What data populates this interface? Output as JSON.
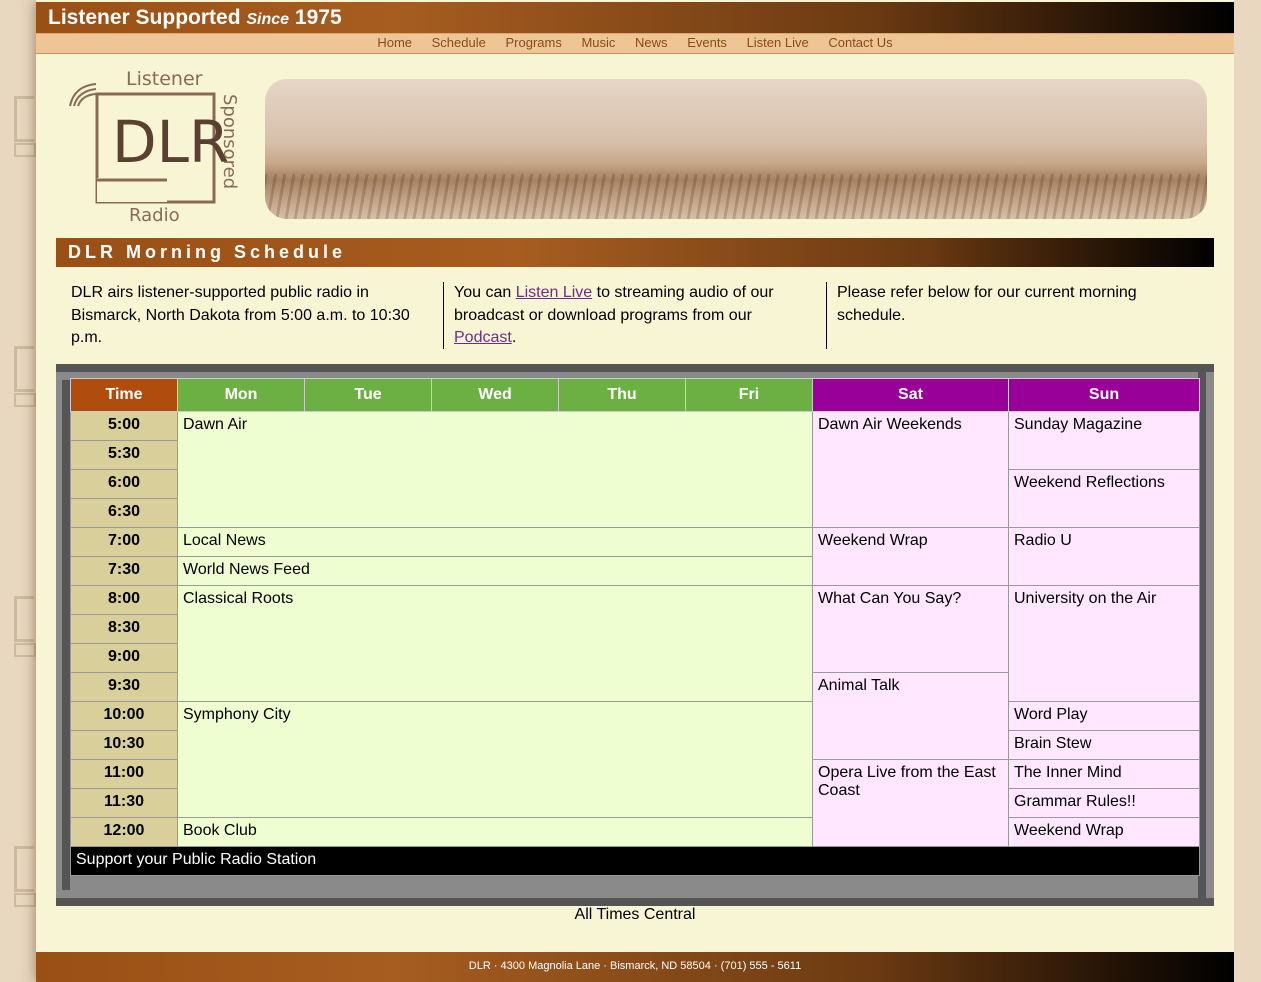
{
  "header": {
    "title_main": "Listener Supported",
    "title_since": "Since",
    "title_year": "1975"
  },
  "nav": [
    "Home",
    "Schedule",
    "Programs",
    "Music",
    "News",
    "Events",
    "Listen Live",
    "Contact Us"
  ],
  "logo": {
    "top_text": "Listener",
    "center_text": "DLR",
    "side_text": "Sponsored",
    "bottom_text": "Radio"
  },
  "section_title": "DLR Morning Schedule",
  "intro": {
    "col1": "DLR airs listener-supported public radio in Bismarck, North Dakota from 5:00 a.m. to 10:30 p.m.",
    "col2_pre": "You can ",
    "col2_link1": "Listen Live",
    "col2_mid": " to streaming audio of our broadcast or download programs from our ",
    "col2_link2": "Podcast",
    "col2_post": ".",
    "col3": "Please refer below for our current morning schedule."
  },
  "schedule": {
    "headers": {
      "time": "Time",
      "weekdays": [
        "Mon",
        "Tue",
        "Wed",
        "Thu",
        "Fri"
      ],
      "sat": "Sat",
      "sun": "Sun"
    },
    "times": [
      "5:00",
      "5:30",
      "6:00",
      "6:30",
      "7:00",
      "7:30",
      "8:00",
      "8:30",
      "9:00",
      "9:30",
      "10:00",
      "10:30",
      "11:00",
      "11:30",
      "12:00"
    ],
    "weekday_programs": [
      "Dawn Air",
      "Local News",
      "World News Feed",
      "Classical Roots",
      "Symphony City",
      "Book Club"
    ],
    "sat_programs": [
      "Dawn Air Weekends",
      "Weekend Wrap",
      "What Can You Say?",
      "Animal Talk",
      "Opera Live from the East Coast"
    ],
    "sun_programs": [
      "Sunday Magazine",
      "Weekend Reflections",
      "Radio U",
      "University on the Air",
      "Word Play",
      "Brain Stew",
      "The Inner Mind",
      "Grammar Rules!!",
      "Weekend Wrap"
    ],
    "footer_row": "Support your Public Radio Station"
  },
  "all_times": "All Times Central",
  "footer": "DLR · 4300 Magnolia Lane · Bismarck, ND 58504 · (701) 555 - 5611",
  "colors": {
    "page_bg": "#f8f5d5",
    "time_header": "#b04c0e",
    "weekday_header": "#6cb043",
    "weekend_header": "#990099",
    "weekday_cell": "#effed1",
    "weekend_cell": "#ffe7ff",
    "time_cell": "#d8cf9a"
  }
}
